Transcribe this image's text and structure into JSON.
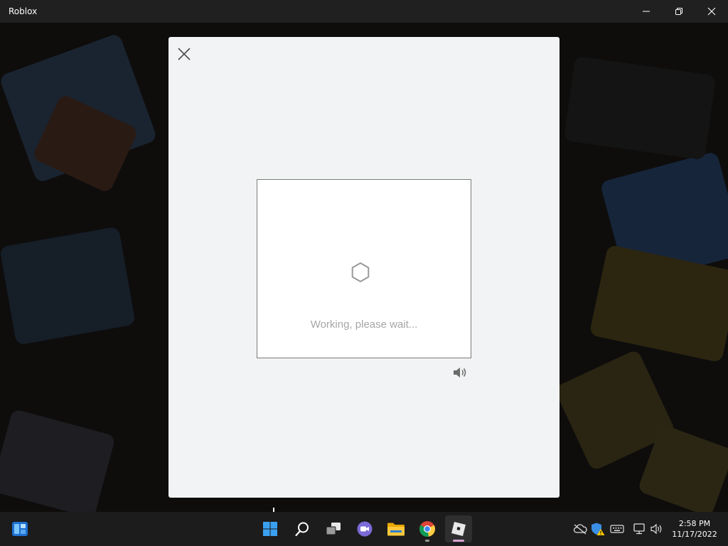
{
  "window": {
    "title": "Roblox",
    "controls": [
      "minimize-icon",
      "restore-icon",
      "close-icon"
    ]
  },
  "dialog": {
    "close_icon": "close-icon",
    "status_text": "Working, please wait...",
    "spinner_icon": "hexagon-spinner-icon",
    "audio_icon": "speaker-icon"
  },
  "taskbar": {
    "widgets_icon": "widgets-icon",
    "apps": [
      {
        "name": "start",
        "icon": "windows-start-icon"
      },
      {
        "name": "search",
        "icon": "search-icon"
      },
      {
        "name": "task-view",
        "icon": "task-view-icon"
      },
      {
        "name": "chat",
        "icon": "teams-chat-icon"
      },
      {
        "name": "file-explorer",
        "icon": "folder-icon"
      },
      {
        "name": "chrome",
        "icon": "chrome-icon"
      },
      {
        "name": "roblox",
        "icon": "roblox-icon",
        "active": true
      }
    ],
    "tray": [
      "onedrive-offline-icon",
      "security-warning-icon",
      "keyboard-icon",
      "network-icon",
      "volume-icon"
    ],
    "time": "2:58 PM",
    "date": "11/17/2022"
  },
  "colors": {
    "titlebar": "#202020",
    "dialog_bg": "#f2f3f4",
    "challenge_bg": "#ffffff",
    "status_text": "#a6a6a6",
    "taskbar": "#1c1c1c"
  }
}
